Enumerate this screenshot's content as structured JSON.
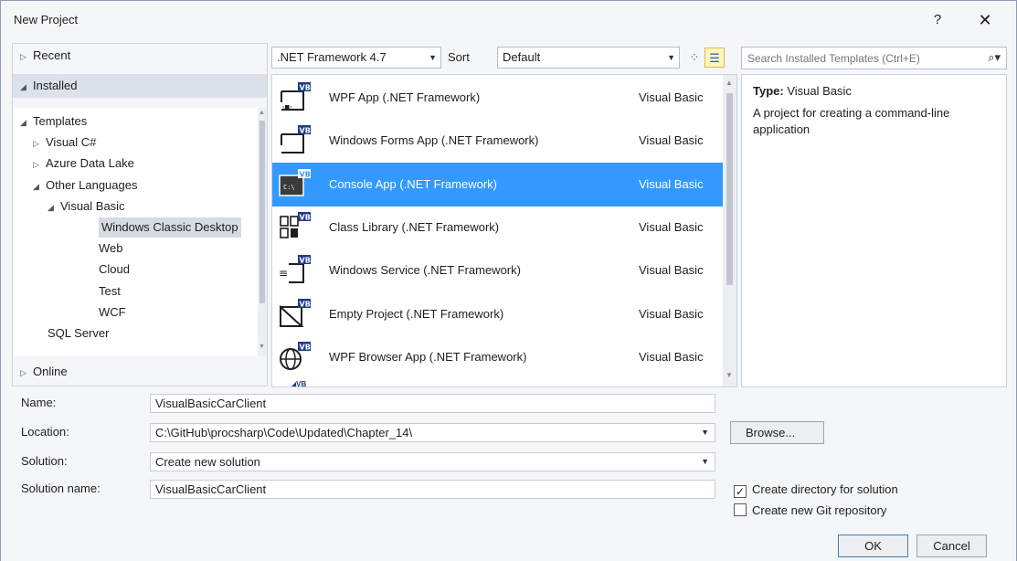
{
  "window": {
    "title": "New Project",
    "help_label": "?",
    "close_label": "✕"
  },
  "left_pane": {
    "recent": "Recent",
    "installed": "Installed",
    "online": "Online",
    "tree": [
      {
        "label": "Templates",
        "arrow": "◢",
        "level": 0
      },
      {
        "label": "Visual C#",
        "arrow": "▷",
        "level": 1
      },
      {
        "label": "Azure Data Lake",
        "arrow": "▷",
        "level": 1
      },
      {
        "label": "Other Languages",
        "arrow": "◢",
        "level": 1
      },
      {
        "label": "Visual Basic",
        "arrow": "◢",
        "level": 2
      },
      {
        "label": "Windows Classic Desktop",
        "arrow": "",
        "level": 3,
        "selected": true
      },
      {
        "label": "Web",
        "arrow": "",
        "level": 3
      },
      {
        "label": "Cloud",
        "arrow": "",
        "level": 3
      },
      {
        "label": "Test",
        "arrow": "",
        "level": 3
      },
      {
        "label": "WCF",
        "arrow": "",
        "level": 3
      },
      {
        "label": "SQL Server",
        "arrow": "",
        "level": 2
      }
    ]
  },
  "toolbar": {
    "framework": ".NET Framework 4.7",
    "sort_by_label": "Sort by:",
    "sort_by_value": "Default"
  },
  "search": {
    "placeholder": "Search Installed Templates (Ctrl+E)"
  },
  "templates": [
    {
      "name": "WPF App (.NET Framework)",
      "language": "Visual Basic",
      "icon": "wpf-app-icon"
    },
    {
      "name": "Windows Forms App (.NET Framework)",
      "language": "Visual Basic",
      "icon": "windows-forms-icon"
    },
    {
      "name": "Console App (.NET Framework)",
      "language": "Visual Basic",
      "icon": "console-app-icon",
      "selected": true
    },
    {
      "name": "Class Library (.NET Framework)",
      "language": "Visual Basic",
      "icon": "class-library-icon"
    },
    {
      "name": "Windows Service (.NET Framework)",
      "language": "Visual Basic",
      "icon": "windows-service-icon"
    },
    {
      "name": "Empty Project (.NET Framework)",
      "language": "Visual Basic",
      "icon": "empty-project-icon"
    },
    {
      "name": "WPF Browser App (.NET Framework)",
      "language": "Visual Basic",
      "icon": "wpf-browser-app-icon"
    }
  ],
  "info": {
    "type_label": "Type:",
    "type_value": "Visual Basic",
    "description": "A project for creating a command-line application"
  },
  "form": {
    "name_label": "Name:",
    "name_value": "VisualBasicCarClient",
    "location_label": "Location:",
    "location_value": "C:\\GitHub\\procsharp\\Code\\Updated\\Chapter_14\\",
    "solution_label": "Solution:",
    "solution_value": "Create new solution",
    "solution_name_label": "Solution name:",
    "solution_name_value": "VisualBasicCarClient",
    "browse_label": "Browse...",
    "create_directory_label": "Create directory for solution",
    "create_directory_checked": true,
    "create_git_label": "Create new Git repository",
    "create_git_checked": false,
    "ok_label": "OK",
    "cancel_label": "Cancel"
  },
  "colors": {
    "selection": "#3399ff",
    "dialog_bg": "#f5f6f8",
    "accent": "#1a5fb4"
  }
}
